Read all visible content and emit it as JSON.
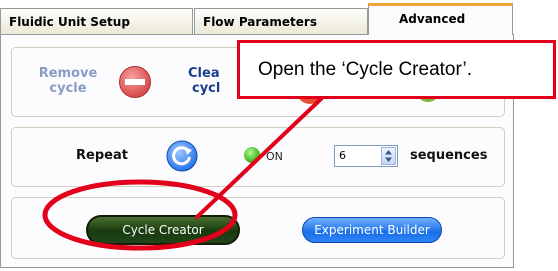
{
  "tabs": [
    {
      "label": "Fluidic Unit Setup"
    },
    {
      "label": "Flow Parameters"
    },
    {
      "label": "Advanced"
    }
  ],
  "remove_cycle": {
    "label_line1": "Remove",
    "label_line2": "cycle"
  },
  "clear_cycle": {
    "label_line1": "Clea",
    "label_line2": "cycl"
  },
  "repeat": {
    "label": "Repeat",
    "indicator_label": "ON",
    "sequence_count": "6",
    "unit": "sequences"
  },
  "buttons": {
    "cycle_creator": "Cycle Creator",
    "experiment_builder": "Experiment Builder"
  },
  "callout": {
    "text": "Open the ‘Cycle Creator’."
  },
  "colors": {
    "tab_accent": "#f3a33b",
    "annotation_red": "#e3001b",
    "remove_icon_red": "#e06060",
    "repeat_icon_blue": "#1f6ee8",
    "indicator_green": "#3bbd1d"
  }
}
